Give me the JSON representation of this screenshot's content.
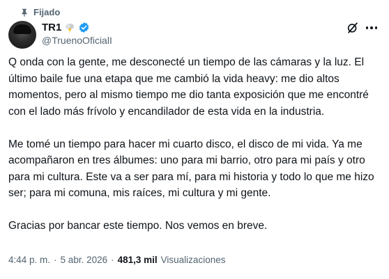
{
  "pinned": {
    "label": "Fijado",
    "icon": "pin-icon"
  },
  "author": {
    "display_name": "TR1",
    "badge_emoji_icon": "cloud-lightning-icon",
    "verified_icon": "verified-badge-icon",
    "verified_color": "#1d9bf0",
    "handle": "@TruenoOficialI"
  },
  "actions": {
    "grok_icon": "grok-icon",
    "more_icon": "more-horizontal-icon"
  },
  "tweet": {
    "paragraphs": [
      "Q onda con la gente, me desconecté un tiempo de las cámaras y la luz. El último baile fue una etapa que me cambió la vida heavy: me dio altos momentos, pero al mismo tiempo me dio tanta exposición que me encontré con el lado más frívolo y encandilador de esta vida en la industria.",
      "Me tomé un tiempo para hacer mi cuarto disco, el disco de mi vida. Ya me acompañaron en tres álbumes: uno para mi barrio, otro para mi país y otro para mi cultura. Este va a ser para mí, para mi historia y todo lo que me hizo ser; para mi comuna, mis raíces, mi cultura y mi gente.",
      "Gracias por bancar este tiempo. Nos vemos en breve."
    ]
  },
  "meta": {
    "time": "4:44 p. m.",
    "separator1": "·",
    "date": "5 abr. 2026",
    "separator2": "·",
    "views_count": "481,3 mil",
    "views_label": "Visualizaciones"
  },
  "colors": {
    "text_primary": "#0f1419",
    "text_secondary": "#536471",
    "accent": "#1d9bf0"
  }
}
